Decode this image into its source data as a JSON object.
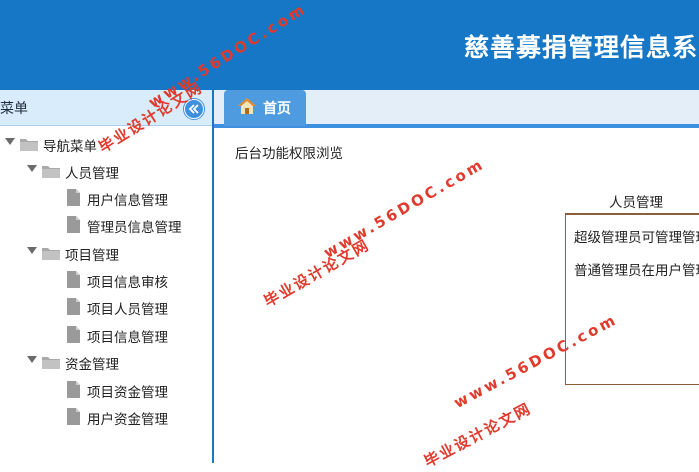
{
  "header": {
    "title": "慈善募捐管理信息系"
  },
  "sidebar": {
    "title": "菜单",
    "collapse_icon": "double-chevron-left-icon",
    "tree": {
      "root": "导航菜单",
      "groups": [
        {
          "label": "人员管理",
          "items": [
            "用户信息管理",
            "管理员信息管理"
          ]
        },
        {
          "label": "项目管理",
          "items": [
            "项目信息审核",
            "项目人员管理",
            "项目信息管理"
          ]
        },
        {
          "label": "资金管理",
          "items": [
            "项目资金管理",
            "用户资金管理"
          ]
        }
      ]
    }
  },
  "tabs": [
    {
      "label": "首页",
      "icon": "home-icon",
      "active": true
    }
  ],
  "main": {
    "text": "后台功能权限浏览",
    "panel": {
      "title": "人员管理",
      "lines": [
        "超级管理员可管理管理",
        "普通管理员在用户管理"
      ]
    }
  },
  "watermark": {
    "cn": "毕业设计论文网",
    "url": "www.56DOC.com"
  },
  "colors": {
    "header": "#1577c6",
    "sidebar_head": "#d9ecfb",
    "tab": "#4f9be0",
    "panel_border": "#8a5f3a",
    "watermark": "#e03a2c"
  }
}
